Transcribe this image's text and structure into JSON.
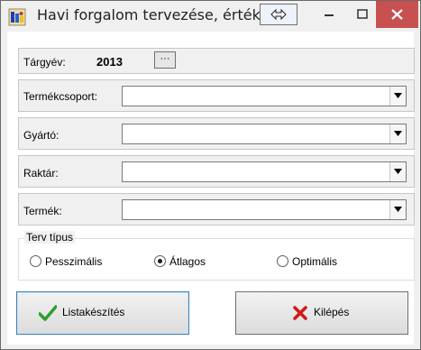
{
  "window": {
    "title": "Havi forgalom tervezése, értékelése",
    "minimize_glyph": "–",
    "maximize_glyph": "☐",
    "close_glyph": "✕",
    "accent_close": "#c75050"
  },
  "form": {
    "year_label": "Tárgyév:",
    "year_value": "2013",
    "year_button": "···",
    "fields": [
      {
        "label": "Termékcsoport:",
        "value": ""
      },
      {
        "label": "Gyártó:",
        "value": ""
      },
      {
        "label": "Raktár:",
        "value": ""
      },
      {
        "label": "Termék:",
        "value": ""
      }
    ]
  },
  "plan_type": {
    "legend": "Terv típus",
    "options": [
      {
        "label": "Pesszimális",
        "selected": false
      },
      {
        "label": "Átlagos",
        "selected": true
      },
      {
        "label": "Optimális",
        "selected": false
      }
    ]
  },
  "buttons": {
    "generate_label": "Listakészítés",
    "exit_label": "Kilépés"
  },
  "icons": {
    "app": "app-figure-icon",
    "resize": "resize-arrows-icon",
    "generate": "checkmark-icon",
    "exit": "red-x-icon"
  }
}
